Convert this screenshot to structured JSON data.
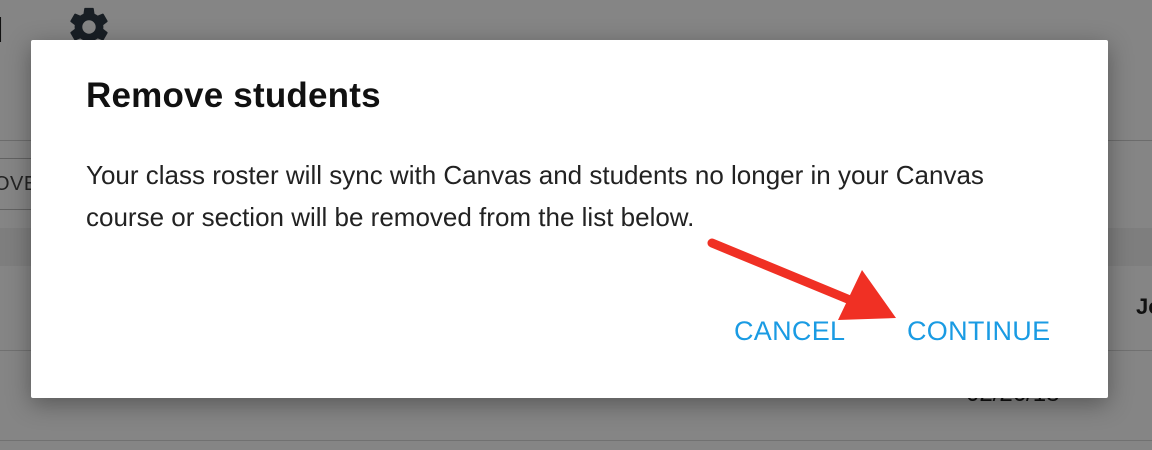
{
  "background": {
    "header_fragment": "l",
    "left_button_fragment": "OVE",
    "right_fragment": "Jo",
    "date_fragment": "02/26/18"
  },
  "dialog": {
    "title": "Remove students",
    "body": "Your class roster will sync with Canvas and students no longer in your Canvas course or section will be removed from the list below.",
    "cancel_label": "CANCEL",
    "continue_label": "CONTINUE",
    "accent_color": "#1a9be3"
  },
  "annotation": {
    "arrow_color": "#f03024",
    "points_to": "continue-button"
  },
  "icons": {
    "gear": "gear-icon"
  }
}
